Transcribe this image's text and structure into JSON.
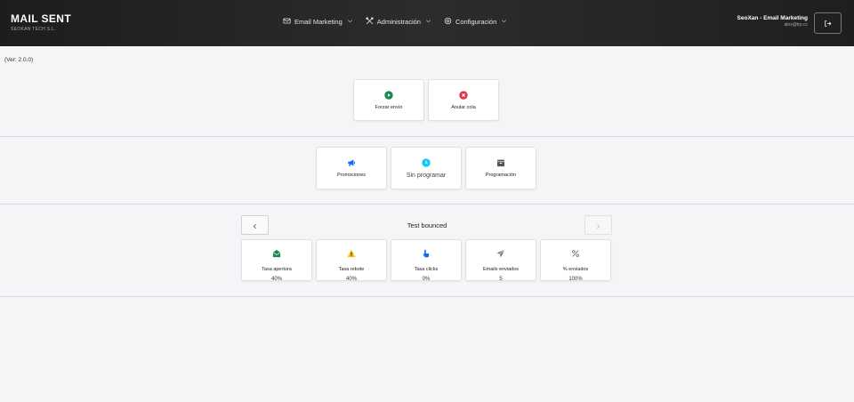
{
  "app": {
    "title": "MAIL SENT",
    "company": "SEOKAN TECH S.L."
  },
  "nav": {
    "items": [
      {
        "label": "Email Marketing",
        "icon": "envelope-icon"
      },
      {
        "label": "Administración",
        "icon": "tools-icon"
      },
      {
        "label": "Configuración",
        "icon": "gear-icon"
      }
    ]
  },
  "user": {
    "name": "SeoXan - Email Marketing",
    "email": "alex@trp.cc"
  },
  "version": "(Ver: 2.0.0)",
  "queue_actions": [
    {
      "label": "Forzar envío",
      "icon": "play-circle-icon",
      "color": "#198754"
    },
    {
      "label": "Anular cola",
      "icon": "x-circle-icon",
      "color": "#dc3545"
    }
  ],
  "sections": [
    {
      "label": "Promociones",
      "icon": "megaphone-icon",
      "color": "#0d6efd"
    },
    {
      "label": "Sin programar",
      "icon": "clock-icon",
      "color": "#0dcaf0"
    },
    {
      "label": "Programación",
      "icon": "calendar-icon",
      "color": "#555555"
    }
  ],
  "campaign": {
    "title": "Test bounced",
    "stats": [
      {
        "label": "Tasa apertura",
        "value": "40%",
        "icon": "envelope-open-icon",
        "color": "#198754"
      },
      {
        "label": "Tasa rebote",
        "value": "40%",
        "icon": "warning-icon",
        "color": "#ffc107"
      },
      {
        "label": "Tasa clicks",
        "value": "0%",
        "icon": "pointer-icon",
        "color": "#0d6efd"
      },
      {
        "label": "Emails enviados",
        "value": "5",
        "icon": "send-icon",
        "color": "#6c757d"
      },
      {
        "label": "% enviados",
        "value": "100%",
        "icon": "percent-icon",
        "color": "#6c757d"
      }
    ]
  }
}
